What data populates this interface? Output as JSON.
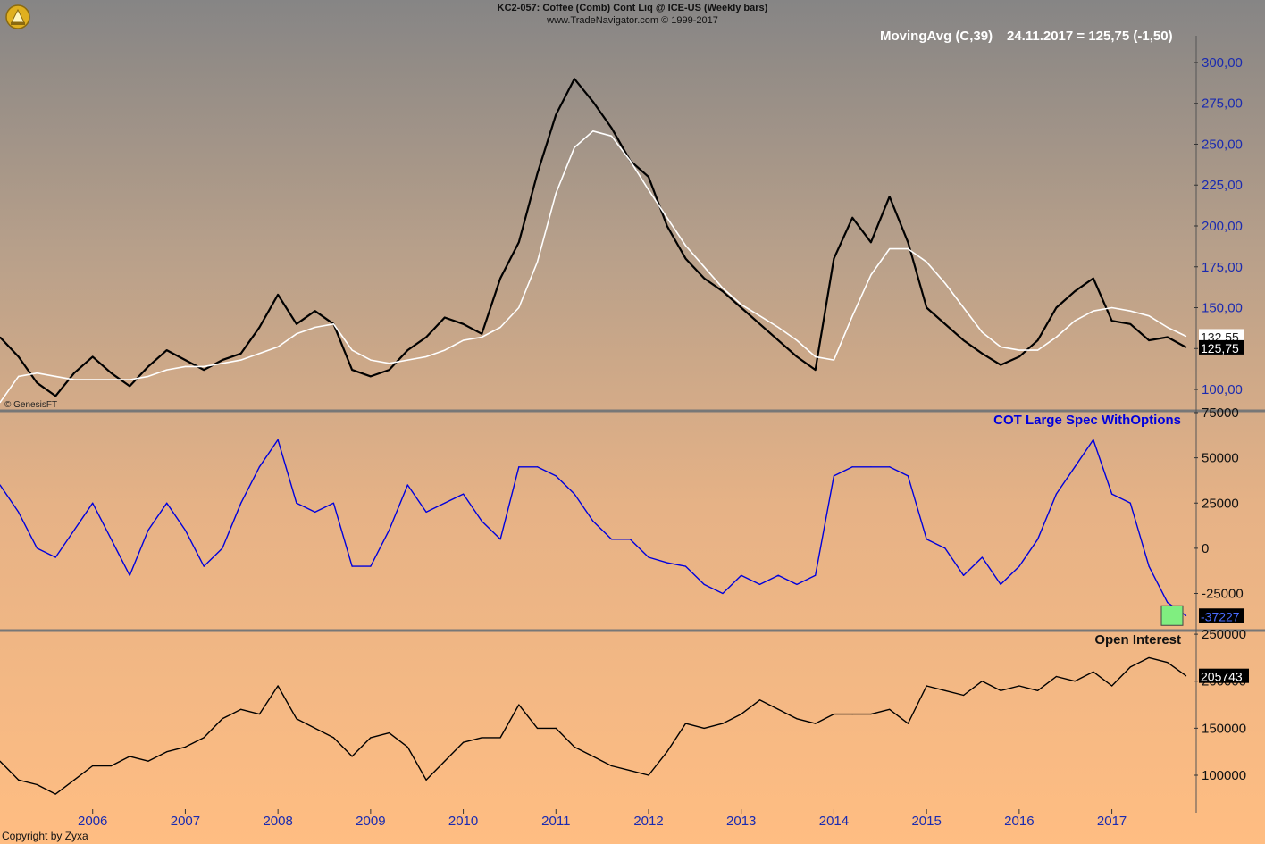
{
  "header": {
    "line1": "KC2-057:  Coffee (Comb) Cont Liq @ ICE-US  (Weekly bars)",
    "line2": "www.TradeNavigator.com © 1999-2017"
  },
  "footer": "Copyright by Zyxa",
  "watermark": "© GenesisFT",
  "colors": {
    "price": "#000000",
    "moving_avg": "#ffffff",
    "cot": "#0000dd",
    "open_interest": "#000000",
    "axis_text_blue": "#1a2ab0",
    "highlight": "#80ee80"
  },
  "chart_data": [
    {
      "name": "price",
      "type": "line",
      "indicator_label": "MovingAvg (C,39)",
      "indicator_value": "24.11.2017 = 125,75 (-1,50)",
      "ylim": [
        88,
        312
      ],
      "yticks": [
        "100,00",
        "125,00",
        "150,00",
        "175,00",
        "200,00",
        "225,00",
        "250,00",
        "275,00",
        "300,00"
      ],
      "ytick_values": [
        100,
        125,
        150,
        175,
        200,
        225,
        250,
        275,
        300
      ],
      "last_price_label": "125,75",
      "last_price": 125.75,
      "ma_label": "132,55",
      "ma_value": 132.55,
      "x": [
        2005.0,
        2005.2,
        2005.4,
        2005.6,
        2005.8,
        2006.0,
        2006.2,
        2006.4,
        2006.6,
        2006.8,
        2007.0,
        2007.2,
        2007.4,
        2007.6,
        2007.8,
        2008.0,
        2008.2,
        2008.4,
        2008.6,
        2008.8,
        2009.0,
        2009.2,
        2009.4,
        2009.6,
        2009.8,
        2010.0,
        2010.2,
        2010.4,
        2010.6,
        2010.8,
        2011.0,
        2011.2,
        2011.4,
        2011.6,
        2011.8,
        2012.0,
        2012.2,
        2012.4,
        2012.6,
        2012.8,
        2013.0,
        2013.2,
        2013.4,
        2013.6,
        2013.8,
        2014.0,
        2014.2,
        2014.4,
        2014.6,
        2014.8,
        2015.0,
        2015.2,
        2015.4,
        2015.6,
        2015.8,
        2016.0,
        2016.2,
        2016.4,
        2016.6,
        2016.8,
        2017.0,
        2017.2,
        2017.4,
        2017.6,
        2017.8
      ],
      "series": [
        {
          "values": [
            132,
            120,
            104,
            96,
            110,
            120,
            110,
            102,
            114,
            124,
            118,
            112,
            118,
            122,
            138,
            158,
            140,
            148,
            140,
            112,
            108,
            112,
            124,
            132,
            144,
            140,
            134,
            168,
            190,
            232,
            268,
            290,
            276,
            260,
            240,
            230,
            200,
            180,
            168,
            160,
            150,
            140,
            130,
            120,
            112,
            180,
            205,
            190,
            218,
            190,
            150,
            140,
            130,
            122,
            115,
            120,
            130,
            150,
            160,
            168,
            142,
            140,
            130,
            132,
            125.75
          ]
        },
        {
          "name": "MovingAvg (C,39)",
          "values": [
            92,
            108,
            110,
            108,
            106,
            106,
            106,
            106,
            108,
            112,
            114,
            114,
            116,
            118,
            122,
            126,
            134,
            138,
            140,
            124,
            118,
            116,
            118,
            120,
            124,
            130,
            132,
            138,
            150,
            178,
            220,
            248,
            258,
            255,
            240,
            222,
            205,
            188,
            175,
            162,
            152,
            145,
            138,
            130,
            120,
            118,
            145,
            170,
            186,
            186,
            178,
            165,
            150,
            135,
            126,
            124,
            124,
            132,
            142,
            148,
            150,
            148,
            145,
            138,
            132.55
          ]
        }
      ]
    },
    {
      "name": "cot",
      "type": "line",
      "indicator_label": "COT Large Spec WithOptions",
      "ylim": [
        -45000,
        75000
      ],
      "yticks": [
        "-25000",
        "0",
        "25000",
        "50000",
        "75000"
      ],
      "ytick_values": [
        -25000,
        0,
        25000,
        50000,
        75000
      ],
      "last_value_label": "-37227",
      "last_value": -37227,
      "x": [
        2005.0,
        2005.2,
        2005.4,
        2005.6,
        2005.8,
        2006.0,
        2006.2,
        2006.4,
        2006.6,
        2006.8,
        2007.0,
        2007.2,
        2007.4,
        2007.6,
        2007.8,
        2008.0,
        2008.2,
        2008.4,
        2008.6,
        2008.8,
        2009.0,
        2009.2,
        2009.4,
        2009.6,
        2009.8,
        2010.0,
        2010.2,
        2010.4,
        2010.6,
        2010.8,
        2011.0,
        2011.2,
        2011.4,
        2011.6,
        2011.8,
        2012.0,
        2012.2,
        2012.4,
        2012.6,
        2012.8,
        2013.0,
        2013.2,
        2013.4,
        2013.6,
        2013.8,
        2014.0,
        2014.2,
        2014.4,
        2014.6,
        2014.8,
        2015.0,
        2015.2,
        2015.4,
        2015.6,
        2015.8,
        2016.0,
        2016.2,
        2016.4,
        2016.6,
        2016.8,
        2017.0,
        2017.2,
        2017.4,
        2017.6,
        2017.8
      ],
      "series": [
        {
          "values": [
            35000,
            20000,
            0,
            -5000,
            10000,
            25000,
            5000,
            -15000,
            10000,
            25000,
            10000,
            -10000,
            0,
            25000,
            45000,
            60000,
            25000,
            20000,
            25000,
            -10000,
            -10000,
            10000,
            35000,
            20000,
            25000,
            30000,
            15000,
            5000,
            45000,
            45000,
            40000,
            30000,
            15000,
            5000,
            5000,
            -5000,
            -8000,
            -10000,
            -20000,
            -25000,
            -15000,
            -20000,
            -15000,
            -20000,
            -15000,
            40000,
            45000,
            45000,
            45000,
            40000,
            5000,
            0,
            -15000,
            -5000,
            -20000,
            -10000,
            5000,
            30000,
            45000,
            60000,
            30000,
            25000,
            -10000,
            -30000,
            -37227
          ]
        }
      ]
    },
    {
      "name": "open_interest",
      "type": "line",
      "indicator_label": "Open Interest",
      "ylim": [
        62000,
        252000
      ],
      "yticks": [
        "100000",
        "150000",
        "200000",
        "250000"
      ],
      "ytick_values": [
        100000,
        150000,
        200000,
        250000
      ],
      "last_value_label": "205743",
      "last_value": 205743,
      "x": [
        2005.0,
        2005.2,
        2005.4,
        2005.6,
        2005.8,
        2006.0,
        2006.2,
        2006.4,
        2006.6,
        2006.8,
        2007.0,
        2007.2,
        2007.4,
        2007.6,
        2007.8,
        2008.0,
        2008.2,
        2008.4,
        2008.6,
        2008.8,
        2009.0,
        2009.2,
        2009.4,
        2009.6,
        2009.8,
        2010.0,
        2010.2,
        2010.4,
        2010.6,
        2010.8,
        2011.0,
        2011.2,
        2011.4,
        2011.6,
        2011.8,
        2012.0,
        2012.2,
        2012.4,
        2012.6,
        2012.8,
        2013.0,
        2013.2,
        2013.4,
        2013.6,
        2013.8,
        2014.0,
        2014.2,
        2014.4,
        2014.6,
        2014.8,
        2015.0,
        2015.2,
        2015.4,
        2015.6,
        2015.8,
        2016.0,
        2016.2,
        2016.4,
        2016.6,
        2016.8,
        2017.0,
        2017.2,
        2017.4,
        2017.6,
        2017.8
      ],
      "series": [
        {
          "values": [
            115000,
            95000,
            90000,
            80000,
            95000,
            110000,
            110000,
            120000,
            115000,
            125000,
            130000,
            140000,
            160000,
            170000,
            165000,
            195000,
            160000,
            150000,
            140000,
            120000,
            140000,
            145000,
            130000,
            95000,
            115000,
            135000,
            140000,
            140000,
            175000,
            150000,
            150000,
            130000,
            120000,
            110000,
            105000,
            100000,
            125000,
            155000,
            150000,
            155000,
            165000,
            180000,
            170000,
            160000,
            155000,
            165000,
            165000,
            165000,
            170000,
            155000,
            195000,
            190000,
            185000,
            200000,
            190000,
            195000,
            190000,
            205000,
            200000,
            210000,
            195000,
            215000,
            225000,
            220000,
            205743
          ]
        }
      ]
    }
  ],
  "x_axis": {
    "labels": [
      "2006",
      "2007",
      "2008",
      "2009",
      "2010",
      "2011",
      "2012",
      "2013",
      "2014",
      "2015",
      "2016",
      "2017"
    ],
    "values": [
      2006,
      2007,
      2008,
      2009,
      2010,
      2011,
      2012,
      2013,
      2014,
      2015,
      2016,
      2017
    ],
    "range": [
      2005.0,
      2017.92
    ]
  }
}
